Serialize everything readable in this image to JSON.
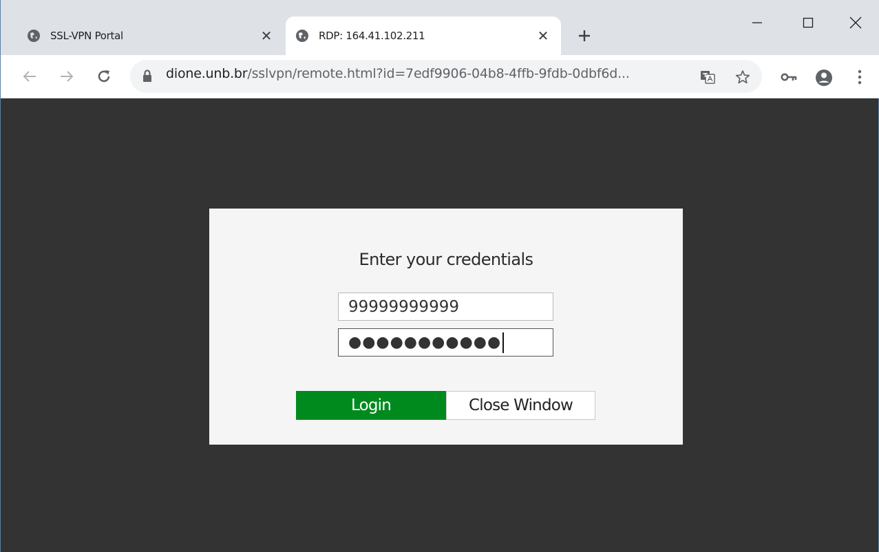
{
  "browser": {
    "tabs": [
      {
        "title": "SSL-VPN Portal",
        "active": false,
        "icon": "globe-icon"
      },
      {
        "title": "RDP: 164.41.102.211",
        "active": true,
        "icon": "globe-icon"
      }
    ],
    "url": {
      "host": "dione.unb.br",
      "path": "/sslvpn/remote.html?id=7edf9906-04b8-4ffb-9fdb-0dbf6d..."
    }
  },
  "dialog": {
    "title": "Enter your credentials",
    "username_value": "99999999999",
    "password_masked": "●●●●●●●●●●●",
    "login_label": "Login",
    "close_label": "Close Window"
  },
  "colors": {
    "page_background": "#333333",
    "dialog_background": "#f5f5f5",
    "login_button": "#008a1e"
  }
}
